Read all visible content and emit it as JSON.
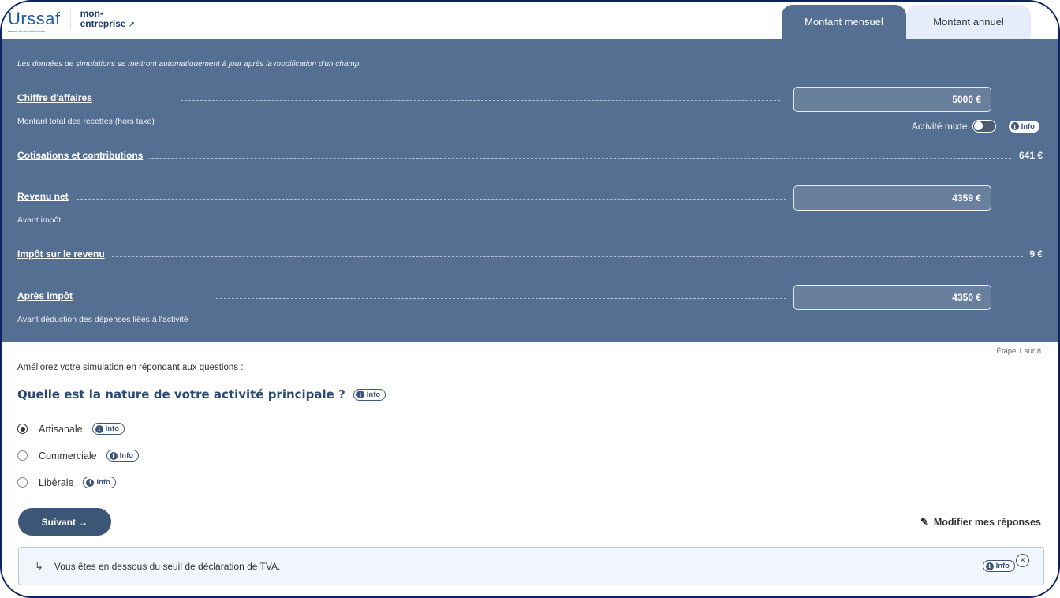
{
  "header": {
    "logo": {
      "brand": "Urssaf",
      "tagline": "service de sécurité sociale",
      "partner_line1": "mon-",
      "partner_line2": "entreprise",
      "external_icon": "↗"
    },
    "tabs": [
      {
        "label": "Montant mensuel",
        "active": true
      },
      {
        "label": "Montant annuel",
        "active": false
      }
    ]
  },
  "simulation": {
    "notice": "Les données de simulations se mettront automatiquement à jour après la modification d'un champ.",
    "rows": [
      {
        "label": "Chiffre d'affaires",
        "sublabel": "Montant total des recettes (hors taxe)",
        "input_value": "5000 €"
      },
      {
        "label": "Cotisations et contributions",
        "value": "641 €"
      },
      {
        "label": "Revenu net",
        "sublabel": "Avant impôt",
        "input_value": "4359 €"
      },
      {
        "label": "Impôt sur le revenu",
        "value": "9 €"
      },
      {
        "label": "Après impôt",
        "sublabel": "Avant déduction des dépenses liées à l'activité",
        "input_value": "4350 €"
      }
    ],
    "mixed_activity": {
      "label": "Activité mixte",
      "enabled": false
    },
    "info_label": "Info",
    "info_icon": "i"
  },
  "questions": {
    "step": "Étape 1 sur 8",
    "intro": "Améliorez votre simulation en répondant aux questions :",
    "title": "Quelle est la nature de votre activité principale ?",
    "options": [
      {
        "label": "Artisanale",
        "checked": true
      },
      {
        "label": "Commerciale",
        "checked": false
      },
      {
        "label": "Libérale",
        "checked": false
      }
    ],
    "next_label": "Suivant →",
    "modify_label": "Modifier mes réponses",
    "modify_icon": "✎"
  },
  "tva_notice": {
    "arrow_icon": "↳",
    "text": "Vous êtes en dessous du seuil de déclaration de TVA.",
    "close_icon": "×"
  },
  "colors": {
    "panel_bg": "#546f91",
    "primary_dark": "#3d5577",
    "tab_inactive": "#e4edf9",
    "notice_bg": "#f1f5fc"
  }
}
